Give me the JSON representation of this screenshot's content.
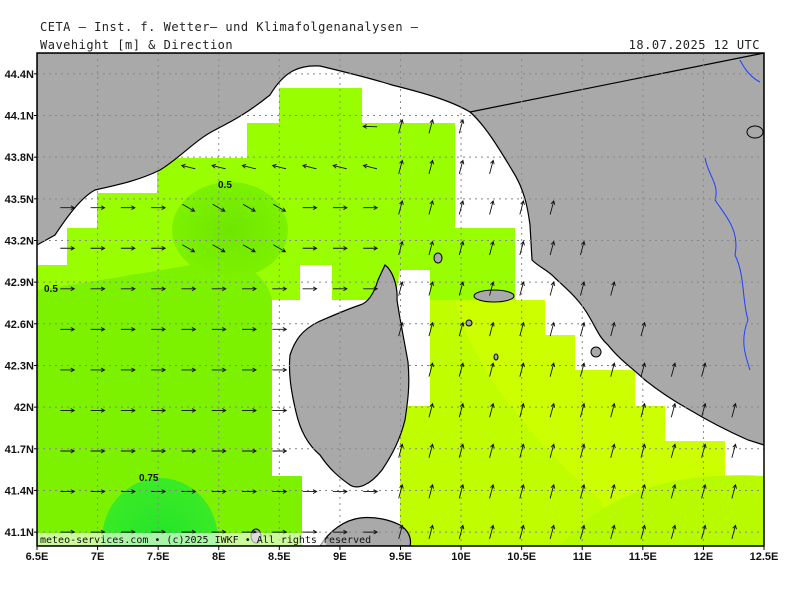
{
  "header": {
    "title": "CETA — Inst. f. Wetter— und Klimafolgenanalysen —",
    "subtitle": "Wavehight [m] & Direction",
    "valid_time": "18.07.2025 12 UTC"
  },
  "credit": "meteo-services.com • (c)2025 IWKF • All rights reserved",
  "colors": {
    "land": "#a9a9a9",
    "sea_low": "#99ff00",
    "sea_mid": "#7cf200",
    "sea_high": "#2ee82e",
    "sea_east": "#ccff00",
    "coast": "#000000",
    "river": "#1f3fff"
  },
  "chart_data": {
    "type": "heatmap",
    "title": "Wavehight [m] & Direction",
    "x_ticks": [
      "6.5E",
      "7E",
      "7.5E",
      "8E",
      "8.5E",
      "9E",
      "9.5E",
      "10E",
      "10.5E",
      "11E",
      "11.5E",
      "12E",
      "12.5E"
    ],
    "y_ticks": [
      "44.4N",
      "44.1N",
      "43.8N",
      "43.5N",
      "43.2N",
      "42.9N",
      "42.6N",
      "42.3N",
      "42N",
      "41.7N",
      "41.4N",
      "41.1N"
    ],
    "lon_range": [
      6.5,
      12.5
    ],
    "lat_range": [
      41.0,
      44.55
    ],
    "contours": [
      {
        "label": "0.5",
        "lon": 8.05,
        "lat": 43.55
      },
      {
        "label": "0.5",
        "lon": 6.6,
        "lat": 42.85
      },
      {
        "label": "0.75",
        "lon": 7.45,
        "lat": 41.45
      }
    ],
    "grid": true
  }
}
